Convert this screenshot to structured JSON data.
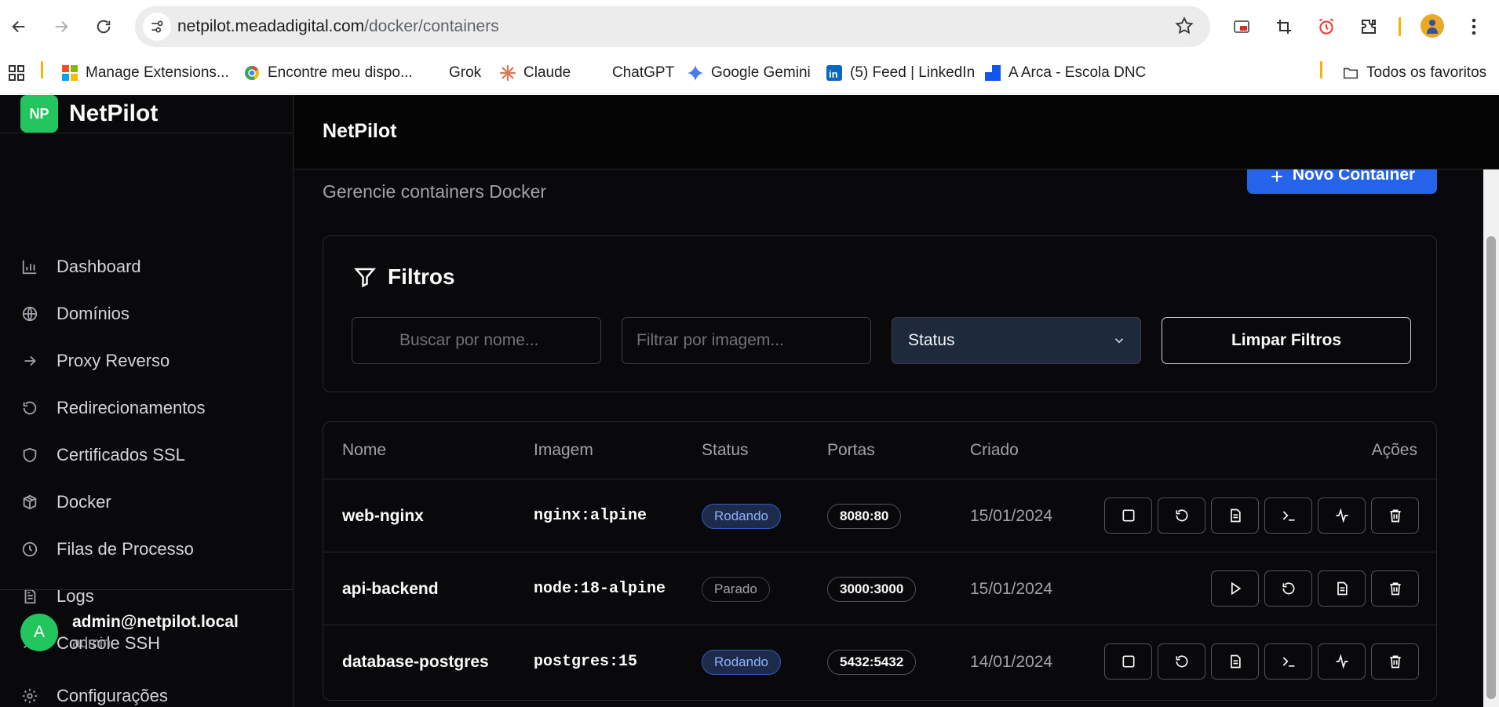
{
  "browser": {
    "url_host": "netpilot.meadadigital.com",
    "url_path": "/docker/containers",
    "bookmarks": [
      {
        "label": "Manage Extensions..."
      },
      {
        "label": "Encontre meu dispo..."
      },
      {
        "label": "Grok"
      },
      {
        "label": "Claude"
      },
      {
        "label": "ChatGPT"
      },
      {
        "label": "Google Gemini"
      },
      {
        "label": "(5) Feed | LinkedIn"
      },
      {
        "label": "A Arca - Escola DNC"
      }
    ],
    "all_bookmarks": "Todos os favoritos"
  },
  "app": {
    "logo_text": "NP",
    "brand": "NetPilot",
    "header_title": "NetPilot"
  },
  "sidebar": {
    "items": [
      {
        "label": "Dashboard",
        "icon": "chart-icon"
      },
      {
        "label": "Domínios",
        "icon": "globe-icon"
      },
      {
        "label": "Proxy Reverso",
        "icon": "arrow-right-icon"
      },
      {
        "label": "Redirecionamentos",
        "icon": "rotate-ccw-icon"
      },
      {
        "label": "Certificados SSL",
        "icon": "shield-icon"
      },
      {
        "label": "Docker",
        "icon": "box-icon"
      },
      {
        "label": "Filas de Processo",
        "icon": "clock-icon"
      },
      {
        "label": "Logs",
        "icon": "file-text-icon"
      },
      {
        "label": "Console SSH",
        "icon": "terminal-icon"
      }
    ],
    "user": {
      "initial": "A",
      "email": "admin@netpilot.local",
      "role": "admin"
    },
    "settings_label": "Configurações"
  },
  "page": {
    "subtitle": "Gerencie containers Docker",
    "new_button": "Novo Container"
  },
  "filters": {
    "title": "Filtros",
    "search_placeholder": "Buscar por nome...",
    "image_placeholder": "Filtrar por imagem...",
    "status_value": "Status",
    "clear_button": "Limpar Filtros"
  },
  "table": {
    "headers": [
      "Nome",
      "Imagem",
      "Status",
      "Portas",
      "Criado",
      "Ações"
    ],
    "rows": [
      {
        "name": "web-nginx",
        "image": "nginx:alpine",
        "status": "Rodando",
        "port": "8080:80",
        "created": "15/01/2024"
      },
      {
        "name": "api-backend",
        "image": "node:18-alpine",
        "status": "Parado",
        "port": "3000:3000",
        "created": "15/01/2024"
      },
      {
        "name": "database-postgres",
        "image": "postgres:15",
        "status": "Rodando",
        "port": "5432:5432",
        "created": "14/01/2024"
      }
    ]
  },
  "colors": {
    "accent_green": "#22c55e",
    "primary_blue": "#2563eb",
    "background": "#09090b",
    "border": "#27272a"
  }
}
